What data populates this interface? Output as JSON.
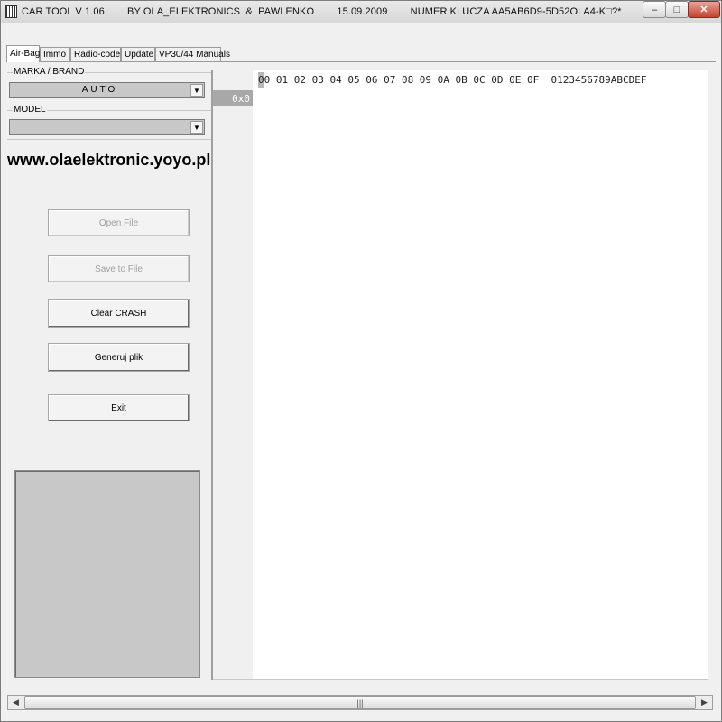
{
  "window": {
    "title": "CAR TOOL V 1.06        BY OLA_ELEKTRONICS  &  PAWLENKO        15.09.2009        NUMER KLUCZA AA5AB6D9-5D52OLA4-K□?*",
    "min_glyph": "–",
    "max_glyph": "□",
    "close_glyph": "✕"
  },
  "tabs": [
    {
      "label": "Air-Bag",
      "active": true
    },
    {
      "label": "Immo",
      "active": false
    },
    {
      "label": "Radio-code",
      "active": false
    },
    {
      "label": "Update",
      "active": false
    },
    {
      "label": "VP30/44 Manuals",
      "active": false
    }
  ],
  "left_panel": {
    "brand_label": "MARKA / BRAND",
    "brand_value": "AUTO",
    "model_label": "MODEL",
    "model_value": "",
    "website": "www.olaelektronic.yoyo.pl",
    "buttons": {
      "open_file": "Open File",
      "save_to_file": "Save to File",
      "clear_crash": "Clear CRASH",
      "generuj_plik": "Generuj plik",
      "exit": "Exit"
    },
    "dropdown_arrow": "▼"
  },
  "hex_editor": {
    "header": "00 01 02 03 04 05 06 07 08 09 0A 0B 0C 0D 0E 0F  0123456789ABCDEF",
    "first_address": "0x0"
  },
  "scrollbar": {
    "left_arrow": "◀",
    "right_arrow": "▶",
    "thumb_grip": "|||"
  },
  "colors": {
    "window_bg": "#f0f0f0",
    "combo_bg": "#c8c8c8",
    "close_button": "#c5432e",
    "address_bg": "#a8a8a8"
  }
}
